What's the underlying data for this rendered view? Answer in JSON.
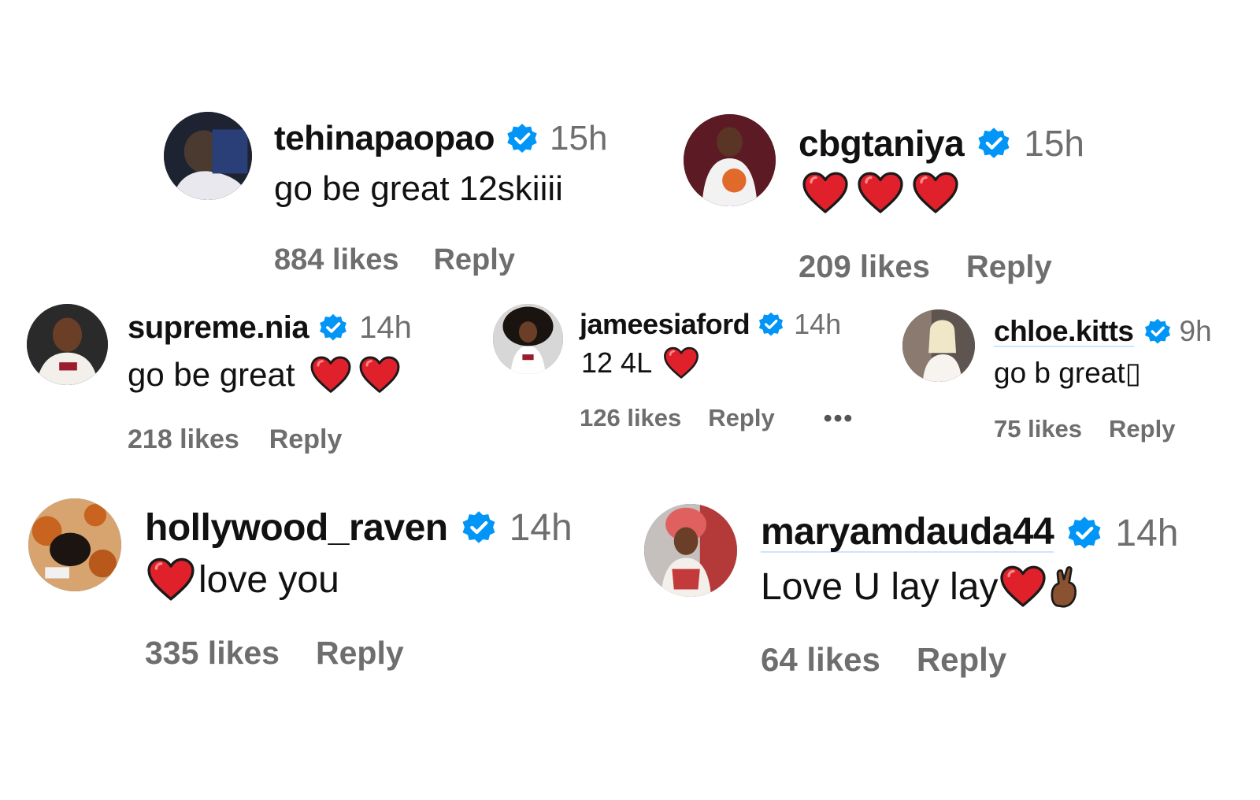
{
  "comments": [
    {
      "username": "tehinapaopao",
      "time": "15h",
      "text": "go be great 12skiiii",
      "likes": "884 likes",
      "reply": "Reply"
    },
    {
      "username": "cbgtaniya",
      "time": "15h",
      "text": "",
      "likes": "209 likes",
      "reply": "Reply"
    },
    {
      "username": "supreme.nia",
      "time": "14h",
      "text": "go be great",
      "likes": "218 likes",
      "reply": "Reply"
    },
    {
      "username": "jameesiaford",
      "time": "14h",
      "text": "12 4L",
      "likes": "126 likes",
      "reply": "Reply",
      "more": "•••"
    },
    {
      "username": "chloe.kitts",
      "time": "9h",
      "text": "go b great▯",
      "likes": "75 likes",
      "reply": "Reply"
    },
    {
      "username": "hollywood_raven",
      "time": "14h",
      "text": "love you",
      "likes": "335 likes",
      "reply": "Reply"
    },
    {
      "username": "maryamdauda44",
      "time": "14h",
      "text": "Love U lay lay",
      "likes": "64 likes",
      "reply": "Reply"
    }
  ],
  "icons": {
    "verified": "verified-badge-icon",
    "heart": "red-heart-emoji",
    "crossed_fingers": "crossed-fingers-emoji"
  },
  "colors": {
    "verified": "#0095f6",
    "heart": "#e0202a",
    "muted_text": "#6e6e6e"
  }
}
